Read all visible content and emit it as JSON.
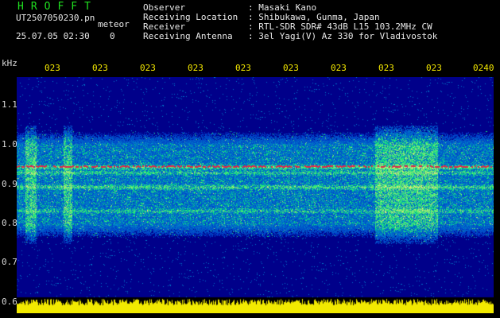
{
  "header": {
    "brand": "HROFFT",
    "filename": "UT2507050230.pn",
    "filename_suffix": "meteor",
    "timestamp": "25.07.05 02:30",
    "count": "0",
    "observer_label": "Observer",
    "observer_value": ": Masaki Kano",
    "location_label": "Receiving Location",
    "location_value": ": Shibukawa, Gunma, Japan",
    "receiver_label": "Receiver",
    "receiver_value": ": RTL-SDR SDR# 43dB L15 103.2MHz CW",
    "antenna_label": "Receiving Antenna",
    "antenna_value": ": 3el Yagi(V) Az 330 for Vladivostok"
  },
  "axis": {
    "unit": "kHz",
    "time_ticks": [
      "023",
      "023",
      "023",
      "023",
      "023",
      "023",
      "023",
      "023",
      "023",
      "0240"
    ],
    "freq_ticks": [
      "1.1",
      "1.0",
      "0.9",
      "0.8",
      "0.7",
      "0.6"
    ]
  },
  "colors": {
    "background": "#000000",
    "spectrogram_bg": "#00008a",
    "tick_text": "#f2e600",
    "brand": "#20e020",
    "signal_line": "#e0284a",
    "noise_bar": "#f2ea00"
  }
}
